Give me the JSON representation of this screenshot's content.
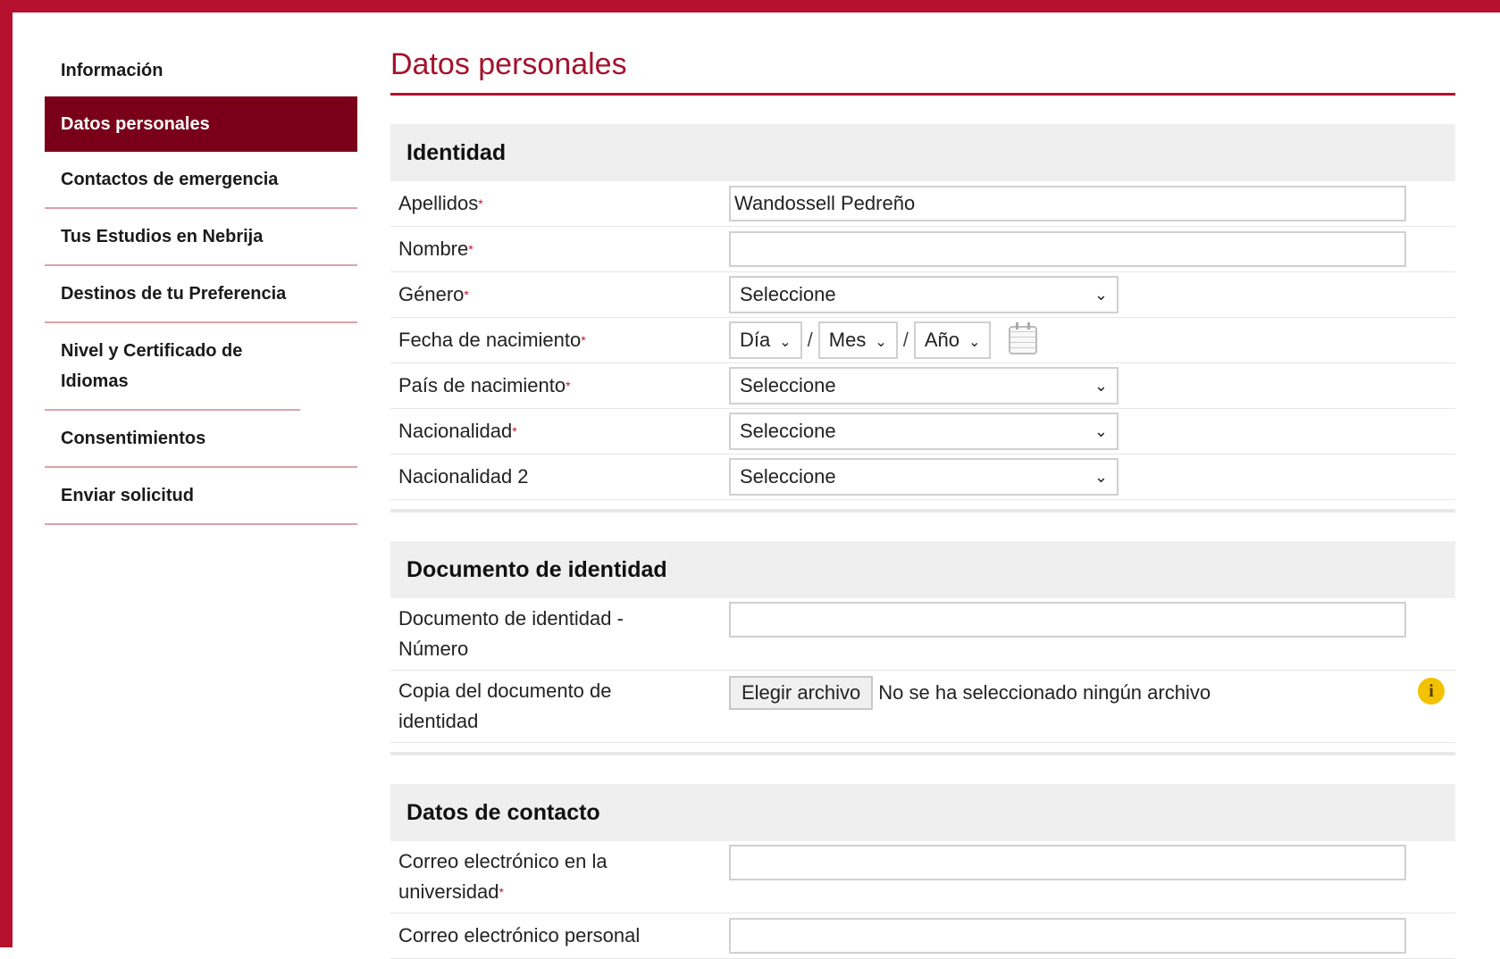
{
  "sidebar": {
    "items": [
      {
        "label": "Información"
      },
      {
        "label": "Datos personales"
      },
      {
        "label": "Contactos de emergencia"
      },
      {
        "label": "Tus Estudios en Nebrija"
      },
      {
        "label": "Destinos de tu Preferencia"
      },
      {
        "label": "Nivel y Certificado de Idiomas"
      },
      {
        "label": "Consentimientos"
      },
      {
        "label": "Enviar solicitud"
      }
    ],
    "active_index": 1
  },
  "page": {
    "title": "Datos personales"
  },
  "identity": {
    "heading": "Identidad",
    "apellidos": {
      "label": "Apellidos",
      "value": "Wandossell Pedreño"
    },
    "nombre": {
      "label": "Nombre",
      "value": ""
    },
    "genero": {
      "label": "Género",
      "selected": "Seleccione"
    },
    "fecha": {
      "label": "Fecha de nacimiento",
      "dia": "Día",
      "mes": "Mes",
      "anio": "Año",
      "separator": "/"
    },
    "pais": {
      "label": "País de nacimiento",
      "selected": "Seleccione"
    },
    "nacionalidad": {
      "label": "Nacionalidad",
      "selected": "Seleccione"
    },
    "nacionalidad2": {
      "label": "Nacionalidad 2",
      "selected": "Seleccione"
    }
  },
  "document": {
    "heading": "Documento de identidad",
    "numero": {
      "label": "Documento de identidad - Número",
      "value": ""
    },
    "copia": {
      "label": "Copia del documento de identidad",
      "button": "Elegir archivo",
      "status": "No se ha seleccionado ningún archivo"
    }
  },
  "contact": {
    "heading": "Datos de contacto",
    "correo_uni": {
      "label": "Correo electrónico en la universidad",
      "value": ""
    },
    "correo_personal": {
      "label": "Correo electrónico personal",
      "value": ""
    }
  },
  "required_marker": "*",
  "colors": {
    "brand": "#b5102e",
    "active_bg": "#7a0019",
    "info": "#f2c200"
  },
  "icons": {
    "chevron": "chevron-down-icon",
    "calendar": "calendar-icon",
    "info": "info-icon"
  }
}
